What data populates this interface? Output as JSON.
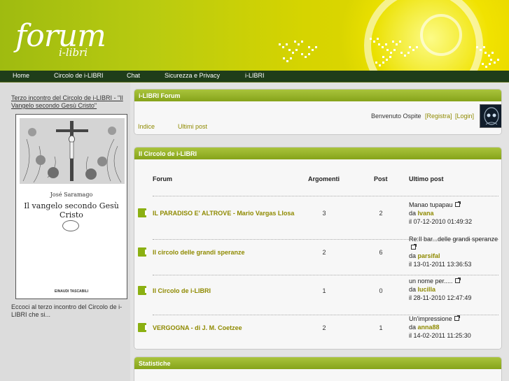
{
  "header": {
    "logo_main": "forum",
    "logo_sub": "i-libri"
  },
  "nav": {
    "items": [
      "Home",
      "Circolo de i-LIBRI",
      "Chat",
      "Sicurezza e Privacy",
      "i-LIBRI"
    ]
  },
  "sidebar": {
    "feature_link": "Terzo incontro del Circolo de i-LIBRI - \"Il Vangelo secondo Gesù Cristo\"",
    "book": {
      "author": "José Saramago",
      "title": "Il vangelo secondo Gesù Cristo",
      "publisher": "EINAUDI TASCABILI"
    },
    "excerpt": "Eccoci al terzo incontro del Circolo de i-LIBRI che si..."
  },
  "forum_panel": {
    "title": "i-LIBRI Forum",
    "links": [
      "Indice",
      "Ultimi post"
    ],
    "welcome": "Benvenuto Ospite",
    "register": "[Registra]",
    "login": "[Login]"
  },
  "circolo_panel": {
    "title": "Il Circolo de i-LIBRI",
    "columns": {
      "forum": "Forum",
      "topics": "Argomenti",
      "posts": "Post",
      "last_post": "Ultimo post"
    },
    "rows": [
      {
        "name": "IL PARADISO E' ALTROVE - Mario Vargas Llosa",
        "topics": "3",
        "posts": "2",
        "last_title": "Manao tupapau",
        "by_prefix": "da",
        "last_user": "Ivana",
        "last_date": "il 07-12-2010 01:49:32"
      },
      {
        "name": "Il circolo delle grandi speranze",
        "topics": "2",
        "posts": "6",
        "last_title": "Re:Il bar...delle grandi speranze",
        "by_prefix": "da",
        "last_user": "parsifal",
        "last_date": "il 13-01-2011 13:36:53"
      },
      {
        "name": "Il Circolo de i-LIBRI",
        "topics": "1",
        "posts": "0",
        "last_title": "un nome per.....",
        "by_prefix": "da",
        "last_user": "lucilla",
        "last_date": "il 28-11-2010 12:47:49"
      },
      {
        "name": "VERGOGNA - di J. M. Coetzee",
        "topics": "2",
        "posts": "1",
        "last_title": "Un'impressione",
        "by_prefix": "da",
        "last_user": "anna88",
        "last_date": "il 14-02-2011 11:25:30"
      }
    ]
  },
  "stats_panel": {
    "title": "Statistiche"
  },
  "colors": {
    "accent_green": "#8bb012",
    "nav_bg": "#1f3d1a",
    "link_gold": "#8f8a00"
  }
}
